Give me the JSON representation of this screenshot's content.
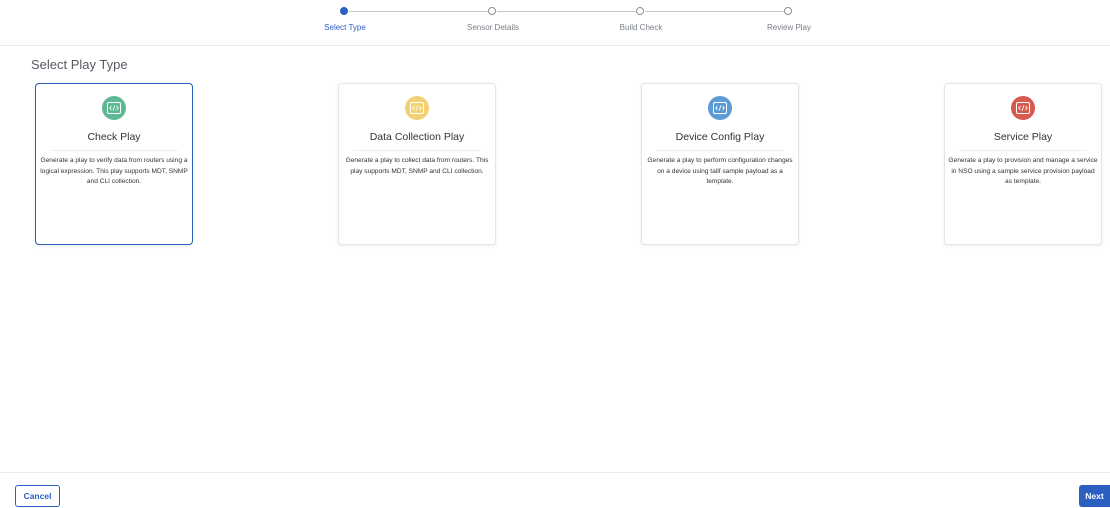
{
  "stepper": {
    "steps": [
      {
        "label": "Select Type",
        "active": true
      },
      {
        "label": "Sensor Details",
        "active": false
      },
      {
        "label": "Build Check",
        "active": false
      },
      {
        "label": "Review Play",
        "active": false
      }
    ]
  },
  "page": {
    "title": "Select Play Type"
  },
  "cards": [
    {
      "title": "Check Play",
      "description": "Generate a play to verify data from routers using a logical expression. This play supports MDT, SNMP and CLI collection.",
      "icon": "code-icon",
      "icon_color": "#5db893",
      "selected": true
    },
    {
      "title": "Data Collection Play",
      "description": "Generate a play to collect data from routers. This play supports MDT, SNMP and CLI collection.",
      "icon": "code-icon",
      "icon_color": "#f2d173",
      "selected": false
    },
    {
      "title": "Device Config Play",
      "description": "Generate a play to perform configuration changes on a device using tailf sample payload as a template.",
      "icon": "code-icon",
      "icon_color": "#5b9bd5",
      "selected": false
    },
    {
      "title": "Service Play",
      "description": "Generate a play to provision and manage a service in NSO using a sample service provision payload as template.",
      "icon": "code-icon",
      "icon_color": "#d65a4e",
      "selected": false
    }
  ],
  "footer": {
    "cancel_label": "Cancel",
    "next_label": "Next"
  },
  "colors": {
    "accent": "#2b5fc1"
  }
}
